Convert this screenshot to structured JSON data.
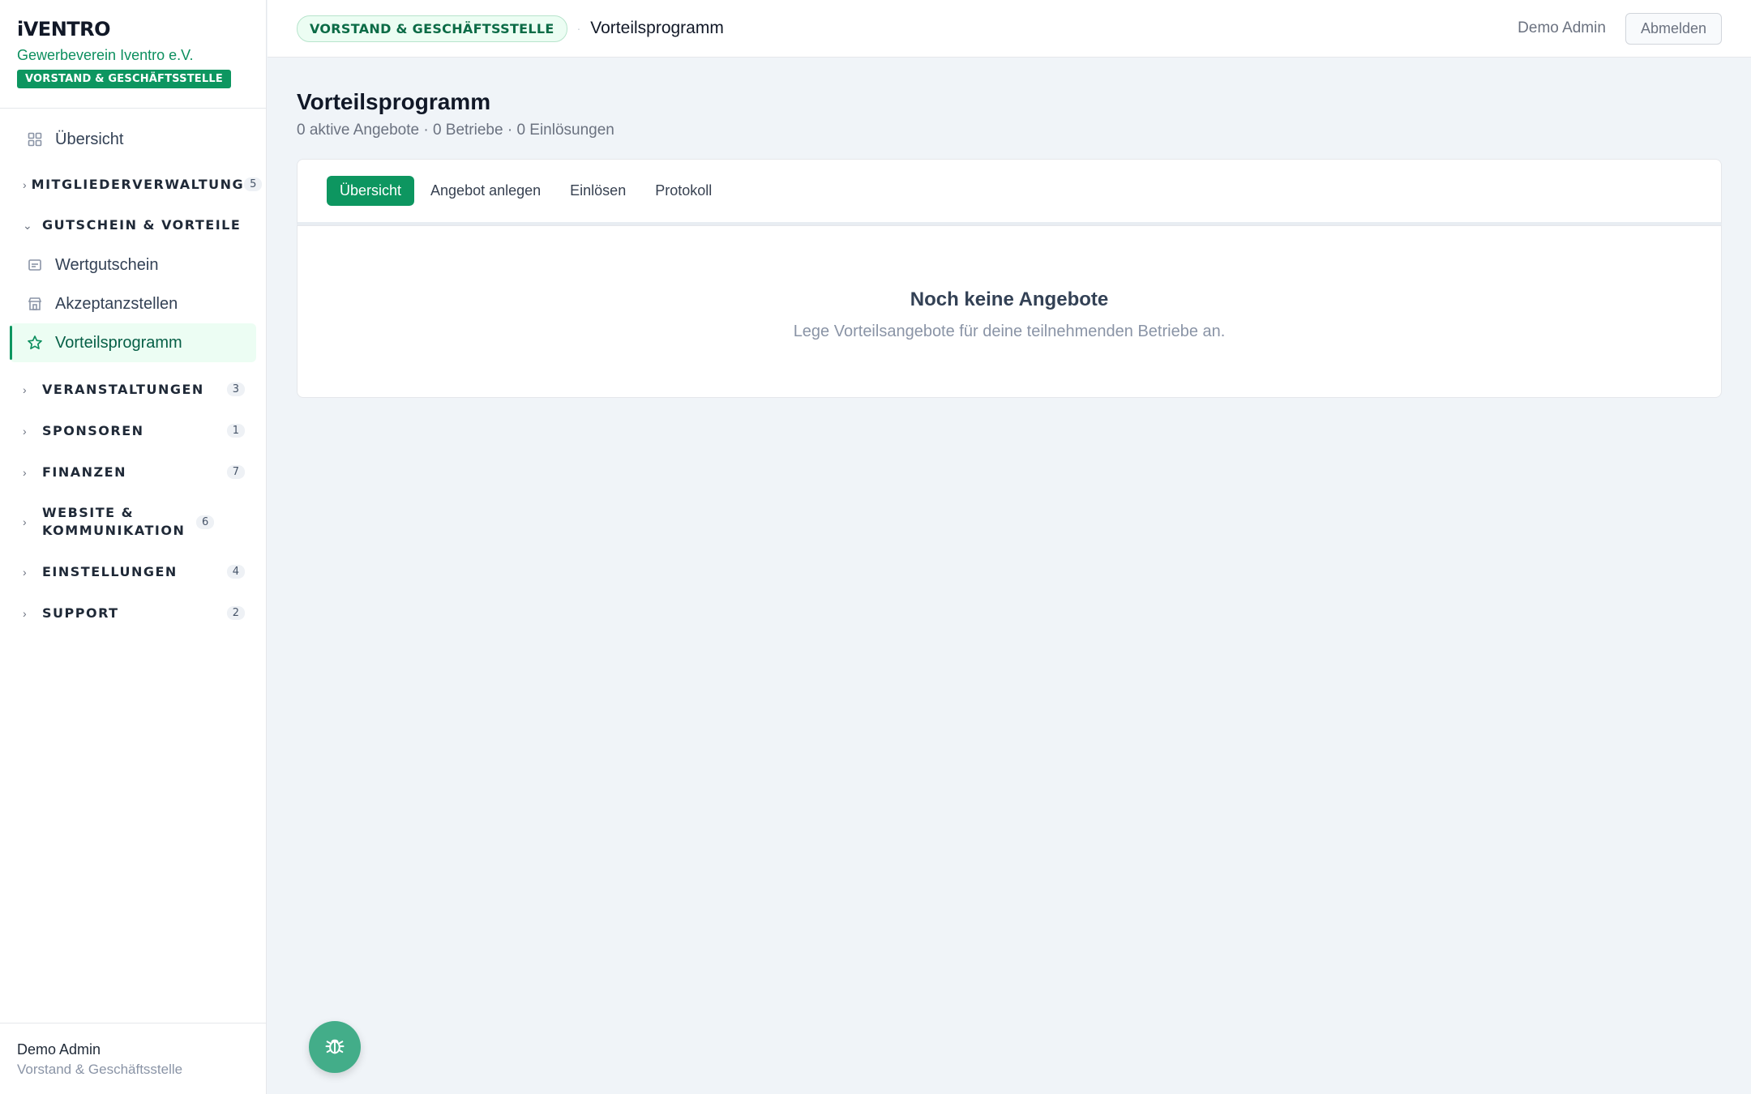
{
  "brand": {
    "logo": "iVENTRO",
    "org": "Gewerbeverein Iventro e.V.",
    "role_badge": "VORSTAND & GESCHÄFTSSTELLE"
  },
  "sidebar": {
    "overview": "Übersicht",
    "groups": [
      {
        "label": "MITGLIEDERVERWALTUNG",
        "count": "5"
      },
      {
        "label": "GUTSCHEIN & VORTEILE"
      },
      {
        "label": "VERANSTALTUNGEN",
        "count": "3"
      },
      {
        "label": "SPONSOREN",
        "count": "1"
      },
      {
        "label": "FINANZEN",
        "count": "7"
      },
      {
        "label": "WEBSITE & KOMMUNIKATION",
        "count": "6"
      },
      {
        "label": "EINSTELLUNGEN",
        "count": "4"
      },
      {
        "label": "SUPPORT",
        "count": "2"
      }
    ],
    "sub_items": [
      "Wertgutschein",
      "Akzeptanzstellen",
      "Vorteilsprogramm"
    ],
    "footer": {
      "name": "Demo Admin",
      "role": "Vorstand & Geschäftsstelle"
    }
  },
  "topbar": {
    "pill": "VORSTAND & GESCHÄFTSSTELLE",
    "separator": "·",
    "breadcrumb": "Vorteilsprogramm",
    "user": "Demo Admin",
    "logout": "Abmelden"
  },
  "main": {
    "title": "Vorteilsprogramm",
    "subtitle": "0 aktive Angebote · 0 Betriebe · 0 Einlösungen",
    "tabs": [
      "Übersicht",
      "Angebot anlegen",
      "Einlösen",
      "Protokoll"
    ],
    "active_tab": "Übersicht",
    "empty": {
      "title": "Noch keine Angebote",
      "text": "Lege Vorteilsangebote für deine teilnehmenden Betriebe an."
    }
  },
  "colors": {
    "accent": "#0d9660",
    "background": "#f0f4f8"
  },
  "icons": {
    "overview": "grid-icon",
    "voucher": "voucher-icon",
    "store": "store-icon",
    "star": "star-icon",
    "bug": "bug-icon"
  }
}
